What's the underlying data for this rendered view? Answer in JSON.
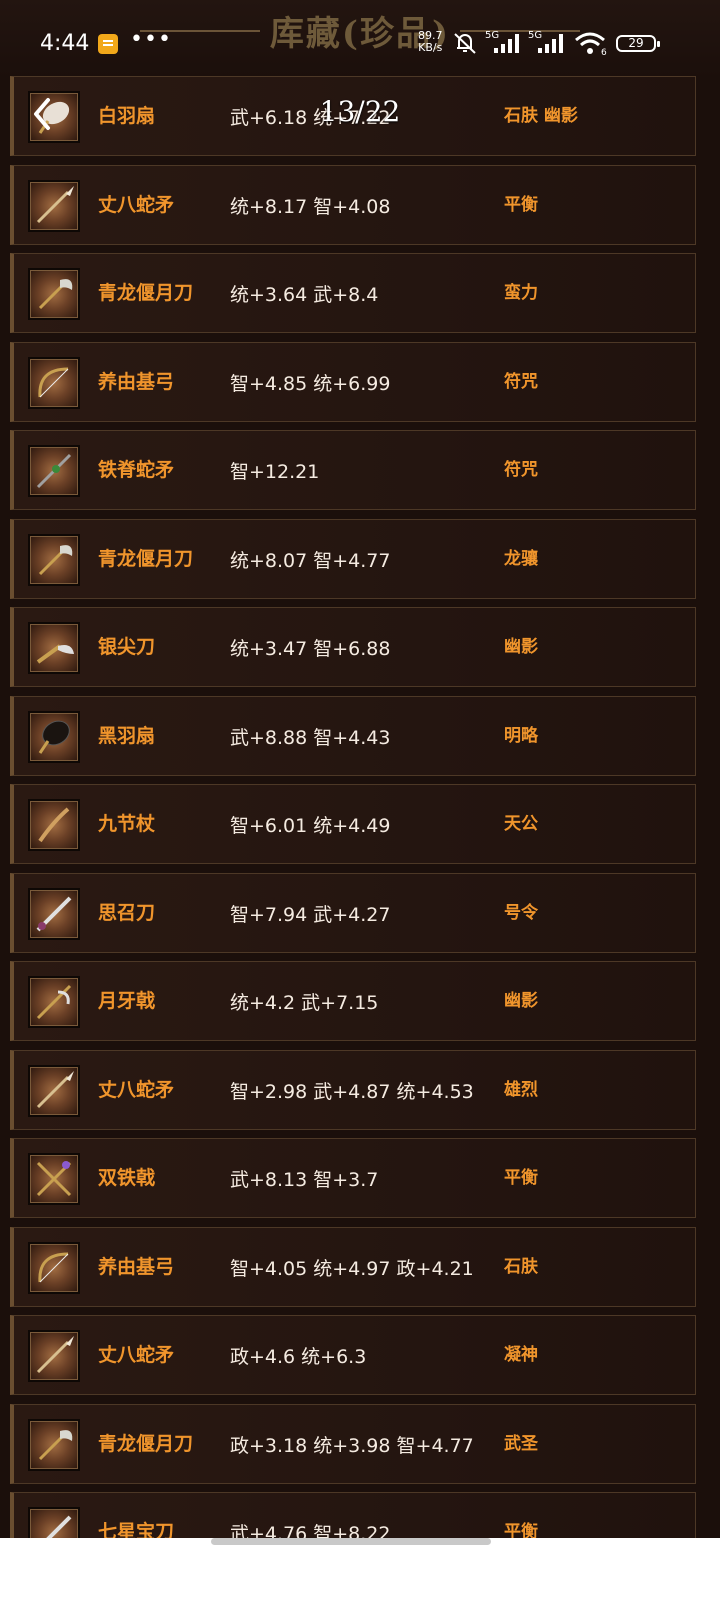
{
  "status_bar": {
    "time": "4:44",
    "net_speed_value": "89.7",
    "net_speed_unit": "KB/s",
    "signal1_label": "5G",
    "signal2_label": "5G",
    "wifi_badge": "6",
    "battery": "29"
  },
  "header": {
    "title": "库藏(珍品)",
    "page_counter": "13/22"
  },
  "items": [
    {
      "name": "白羽扇",
      "stats": "武+6.18 统+7.22",
      "tags": "石肤 幽影",
      "icon": "white-feather-fan-icon"
    },
    {
      "name": "丈八蛇矛",
      "stats": "统+8.17 智+4.08",
      "tags": "平衡",
      "icon": "serpent-spear-icon"
    },
    {
      "name": "青龙偃月刀",
      "stats": "统+3.64 武+8.4",
      "tags": "蛮力",
      "icon": "green-dragon-blade-icon"
    },
    {
      "name": "养由基弓",
      "stats": "智+4.85 统+6.99",
      "tags": "符咒",
      "icon": "bow-icon"
    },
    {
      "name": "铁脊蛇矛",
      "stats": "智+12.21",
      "tags": "符咒",
      "icon": "iron-spear-icon"
    },
    {
      "name": "青龙偃月刀",
      "stats": "统+8.07 智+4.77",
      "tags": "龙骧",
      "icon": "green-dragon-blade-icon"
    },
    {
      "name": "银尖刀",
      "stats": "统+3.47 智+6.88",
      "tags": "幽影",
      "icon": "silver-blade-icon"
    },
    {
      "name": "黑羽扇",
      "stats": "武+8.88 智+4.43",
      "tags": "明略",
      "icon": "black-feather-fan-icon"
    },
    {
      "name": "九节杖",
      "stats": "智+6.01 统+4.49",
      "tags": "天公",
      "icon": "staff-icon"
    },
    {
      "name": "思召刀",
      "stats": "智+7.94 武+4.27",
      "tags": "号令",
      "icon": "sabre-icon"
    },
    {
      "name": "月牙戟",
      "stats": "统+4.2 武+7.15",
      "tags": "幽影",
      "icon": "crescent-halberd-icon"
    },
    {
      "name": "丈八蛇矛",
      "stats": "智+2.98 武+4.87 统+4.53",
      "tags": "雄烈",
      "icon": "serpent-spear-icon"
    },
    {
      "name": "双铁戟",
      "stats": "武+8.13 智+3.7",
      "tags": "平衡",
      "icon": "twin-halberd-icon"
    },
    {
      "name": "养由基弓",
      "stats": "智+4.05 统+4.97 政+4.21",
      "tags": "石肤",
      "icon": "bow-icon"
    },
    {
      "name": "丈八蛇矛",
      "stats": "政+4.6 统+6.3",
      "tags": "凝神",
      "icon": "serpent-spear-icon"
    },
    {
      "name": "青龙偃月刀",
      "stats": "政+3.18 统+3.98 智+4.77",
      "tags": "武圣",
      "icon": "green-dragon-blade-icon"
    },
    {
      "name": "七星宝刀",
      "stats": "武+4.76 智+8.22",
      "tags": "平衡",
      "icon": "seven-star-sword-icon"
    }
  ]
}
